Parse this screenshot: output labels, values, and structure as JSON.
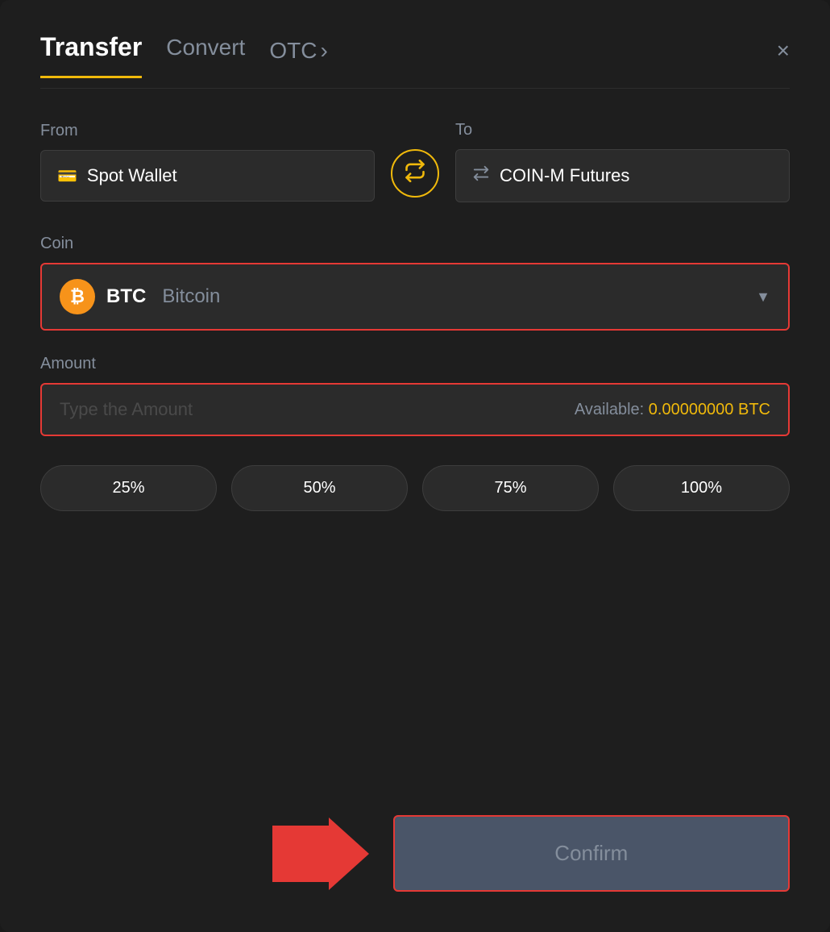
{
  "header": {
    "tab_active": "Transfer",
    "tab_convert": "Convert",
    "tab_otc": "OTC",
    "close_label": "×"
  },
  "from": {
    "label": "From",
    "wallet_name": "Spot Wallet",
    "wallet_icon": "💳"
  },
  "to": {
    "label": "To",
    "wallet_name": "COIN-M Futures",
    "wallet_icon": "↑"
  },
  "swap": {
    "icon": "⇄"
  },
  "coin": {
    "label": "Coin",
    "symbol": "BTC",
    "name": "Bitcoin",
    "chevron": "▼"
  },
  "amount": {
    "label": "Amount",
    "placeholder": "Type the Amount",
    "available_label": "Available:",
    "available_value": "0.00000000 BTC"
  },
  "percentages": [
    "25%",
    "50%",
    "75%",
    "100%"
  ],
  "confirm_button": "Confirm",
  "otc_chevron": "›"
}
